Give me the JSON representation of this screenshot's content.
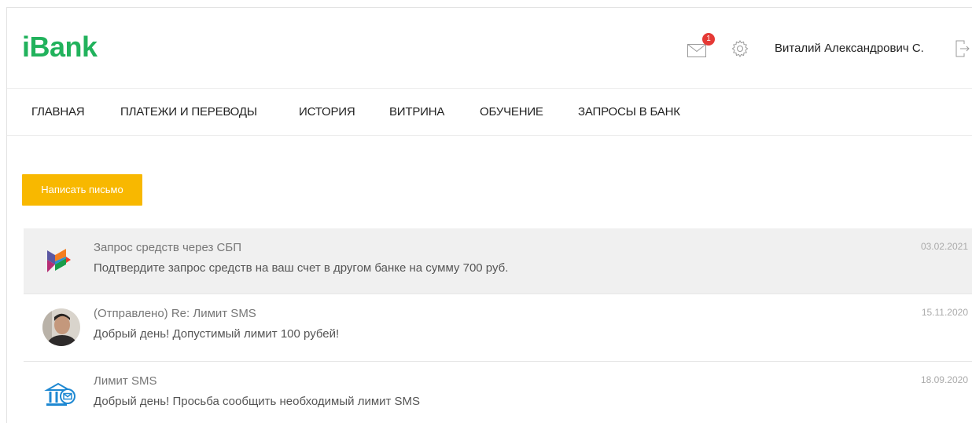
{
  "header": {
    "logo": "iBank",
    "mail_badge": "1",
    "user_name": "Виталий Александрович С."
  },
  "nav": {
    "items": [
      {
        "label": "ГЛАВНАЯ"
      },
      {
        "label": "ПЛАТЕЖИ И ПЕРЕВОДЫ"
      },
      {
        "label": "ИСТОРИЯ"
      },
      {
        "label": "ВИТРИНА"
      },
      {
        "label": "ОБУЧЕНИЕ"
      },
      {
        "label": "ЗАПРОСЫ В БАНК"
      }
    ]
  },
  "compose_label": "Написать письмо",
  "messages": [
    {
      "icon": "sbp-logo-icon",
      "subject": "Запрос средств через СБП",
      "body": "Подтвердите запрос средств на ваш счет в другом банке на сумму 700 руб.",
      "date": "03.02.2021"
    },
    {
      "icon": "avatar",
      "subject": "(Отправлено) Re: Лимит SMS",
      "body": "Добрый день! Допустимый лимит 100 рубей!",
      "date": "15.11.2020"
    },
    {
      "icon": "bank-mail-icon",
      "subject": "Лимит SMS",
      "body": "Добрый день! Просьба сообщить необходимый лимит SMS",
      "date": "18.09.2020"
    }
  ],
  "colors": {
    "brand": "#21b25c",
    "accent": "#f8b800",
    "badge": "#e53935",
    "row_highlight": "#f0f0f0"
  }
}
